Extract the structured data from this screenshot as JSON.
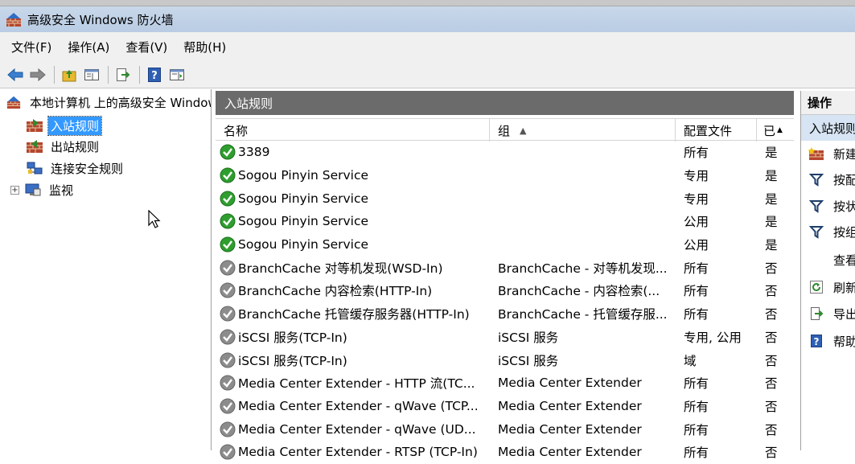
{
  "window": {
    "title": "高级安全 Windows 防火墙"
  },
  "menu": [
    "文件(F)",
    "操作(A)",
    "查看(V)",
    "帮助(H)"
  ],
  "tree": {
    "root": "本地计算机 上的高级安全 Windows 防火墙",
    "items": [
      {
        "label": "入站规则",
        "icon": "inbound-rules-icon",
        "selected": true
      },
      {
        "label": "出站规则",
        "icon": "outbound-rules-icon"
      },
      {
        "label": "连接安全规则",
        "icon": "connection-security-icon"
      },
      {
        "label": "监视",
        "icon": "monitor-icon"
      }
    ]
  },
  "center": {
    "header": "入站规则",
    "columns": [
      "名称",
      "组",
      "配置文件",
      "已"
    ],
    "rows": [
      {
        "name": "3389",
        "group": "",
        "profile": "所有",
        "enabled": "是",
        "status": "enabled"
      },
      {
        "name": "Sogou Pinyin Service",
        "group": "",
        "profile": "专用",
        "enabled": "是",
        "status": "enabled"
      },
      {
        "name": "Sogou Pinyin Service",
        "group": "",
        "profile": "专用",
        "enabled": "是",
        "status": "enabled"
      },
      {
        "name": "Sogou Pinyin Service",
        "group": "",
        "profile": "公用",
        "enabled": "是",
        "status": "enabled"
      },
      {
        "name": "Sogou Pinyin Service",
        "group": "",
        "profile": "公用",
        "enabled": "是",
        "status": "enabled"
      },
      {
        "name": "BranchCache 对等机发现(WSD-In)",
        "group": "BranchCache - 对等机发现...",
        "profile": "所有",
        "enabled": "否",
        "status": "disabled"
      },
      {
        "name": "BranchCache 内容检索(HTTP-In)",
        "group": "BranchCache - 内容检索(...",
        "profile": "所有",
        "enabled": "否",
        "status": "disabled"
      },
      {
        "name": "BranchCache 托管缓存服务器(HTTP-In)",
        "group": "BranchCache - 托管缓存服...",
        "profile": "所有",
        "enabled": "否",
        "status": "disabled"
      },
      {
        "name": "iSCSI 服务(TCP-In)",
        "group": "iSCSI 服务",
        "profile": "专用, 公用",
        "enabled": "否",
        "status": "disabled"
      },
      {
        "name": "iSCSI 服务(TCP-In)",
        "group": "iSCSI 服务",
        "profile": "域",
        "enabled": "否",
        "status": "disabled"
      },
      {
        "name": "Media Center Extender - HTTP 流(TC...",
        "group": "Media Center Extender",
        "profile": "所有",
        "enabled": "否",
        "status": "disabled"
      },
      {
        "name": "Media Center Extender - qWave (TCP...",
        "group": "Media Center Extender",
        "profile": "所有",
        "enabled": "否",
        "status": "disabled"
      },
      {
        "name": "Media Center Extender - qWave (UD...",
        "group": "Media Center Extender",
        "profile": "所有",
        "enabled": "否",
        "status": "disabled"
      },
      {
        "name": "Media Center Extender - RTSP (TCP-In)",
        "group": "Media Center Extender",
        "profile": "所有",
        "enabled": "否",
        "status": "disabled"
      }
    ]
  },
  "actions": {
    "header": "操作",
    "section": "入站规则",
    "items": [
      {
        "label": "新建规则...",
        "icon": "new-rule-icon"
      },
      {
        "label": "按配置文件筛选",
        "icon": "filter-icon"
      },
      {
        "label": "按状态筛选",
        "icon": "filter-icon"
      },
      {
        "label": "按组筛选",
        "icon": "filter-icon"
      },
      {
        "label": "查看",
        "icon": ""
      },
      {
        "label": "刷新",
        "icon": "refresh-icon"
      },
      {
        "label": "导出列表...",
        "icon": "export-icon"
      },
      {
        "label": "帮助",
        "icon": "help-icon"
      }
    ]
  },
  "colors": {
    "enabled": "#2e9e2e",
    "disabled": "#8c8c8c",
    "selection": "#3399ff",
    "panel_header": "#6b6b6b"
  }
}
